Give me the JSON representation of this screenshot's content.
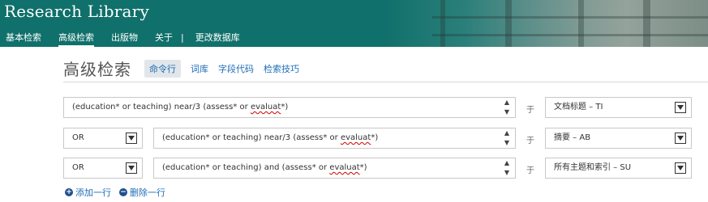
{
  "header": {
    "logo": "Research Library",
    "nav": [
      "基本检索",
      "高级检索",
      "出版物",
      "关于",
      "更改数据库"
    ],
    "nav_separator": "|"
  },
  "page": {
    "title": "高级检索",
    "tabs": [
      "命令行",
      "词库",
      "字段代码",
      "检索技巧"
    ],
    "selected_tab": "命令行"
  },
  "rows": [
    {
      "operator": null,
      "query_before": "(education* or teaching) near/3 (assess* or ",
      "query_flagged": "evaluat",
      "query_after": "*)",
      "in_label": "于",
      "field": "文档标题 – TI"
    },
    {
      "operator": "OR",
      "query_before": "(education* or teaching) near/3 (assess* or ",
      "query_flagged": "evaluat",
      "query_after": "*)",
      "in_label": "于",
      "field": "摘要 – AB"
    },
    {
      "operator": "OR",
      "query_before": "(education* or teaching) and (assess* or ",
      "query_flagged": "evaluat",
      "query_after": "*)",
      "in_label": "于",
      "field": "所有主题和索引 – SU"
    }
  ],
  "actions": {
    "add_row": "添加一行",
    "remove_row": "删除一行"
  },
  "colors": {
    "header_bg": "#10706b",
    "link": "#1f6db5",
    "spellcheck": "#d00000"
  }
}
